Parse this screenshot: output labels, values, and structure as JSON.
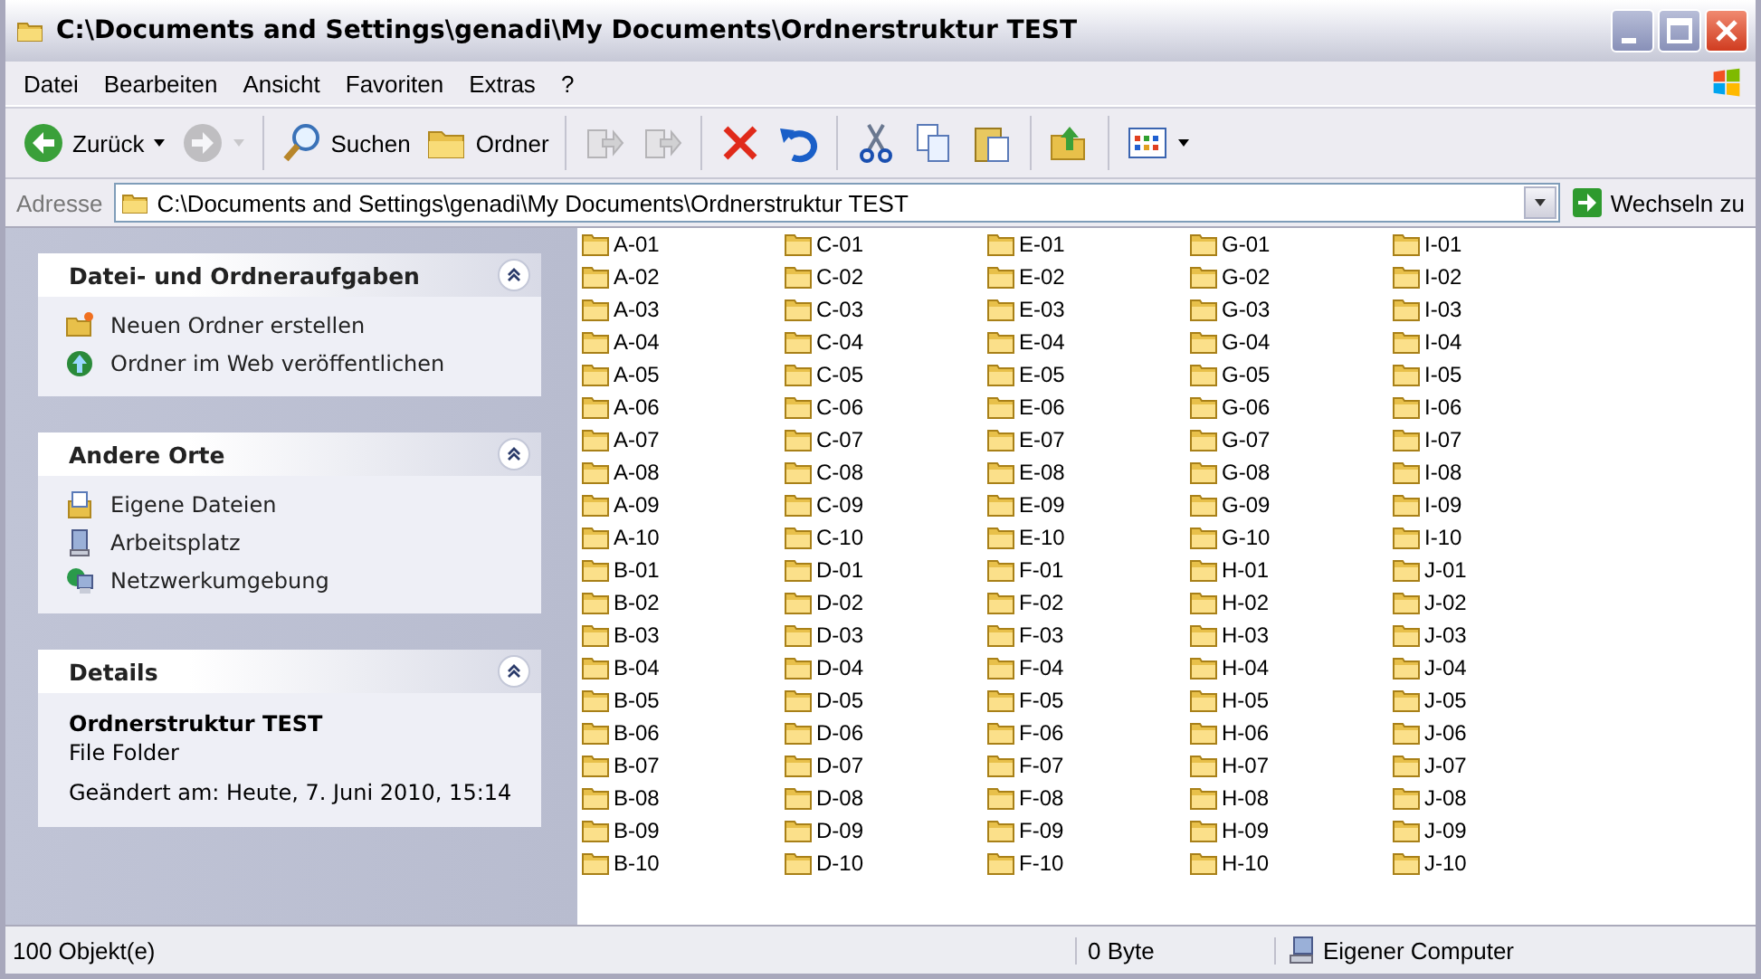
{
  "window": {
    "title": "C:\\Documents and Settings\\genadi\\My Documents\\Ordnerstruktur TEST"
  },
  "menu": [
    "Datei",
    "Bearbeiten",
    "Ansicht",
    "Favoriten",
    "Extras",
    "?"
  ],
  "toolbar": [
    {
      "kind": "back",
      "label": "Zurück",
      "disabled": false,
      "dropdown": true
    },
    {
      "kind": "forward",
      "disabled": true,
      "dropdown": true
    },
    {
      "kind": "sep"
    },
    {
      "kind": "search",
      "label": "Suchen",
      "disabled": false
    },
    {
      "kind": "folders",
      "label": "Ordner",
      "disabled": false
    },
    {
      "kind": "sep"
    },
    {
      "kind": "moveto",
      "disabled": true
    },
    {
      "kind": "copyto",
      "disabled": true
    },
    {
      "kind": "sep"
    },
    {
      "kind": "delete",
      "disabled": false
    },
    {
      "kind": "undo",
      "disabled": false
    },
    {
      "kind": "sep"
    },
    {
      "kind": "cut",
      "disabled": false
    },
    {
      "kind": "copy",
      "disabled": false
    },
    {
      "kind": "paste",
      "disabled": false
    },
    {
      "kind": "sep"
    },
    {
      "kind": "up",
      "disabled": false
    },
    {
      "kind": "sep"
    },
    {
      "kind": "views",
      "disabled": false,
      "dropdown": true
    }
  ],
  "address": {
    "label": "Adresse",
    "value": "C:\\Documents and Settings\\genadi\\My Documents\\Ordnerstruktur TEST",
    "go": "Wechseln zu"
  },
  "panels": [
    {
      "title": "Datei- und Ordneraufgaben",
      "items": [
        {
          "kind": "newfolder",
          "label": "Neuen Ordner erstellen"
        },
        {
          "kind": "web",
          "label": "Ordner im Web veröffentlichen"
        }
      ]
    },
    {
      "title": "Andere Orte",
      "items": [
        {
          "kind": "docs",
          "label": "Eigene Dateien"
        },
        {
          "kind": "computer",
          "label": "Arbeitsplatz"
        },
        {
          "kind": "network",
          "label": "Netzwerkumgebung"
        }
      ]
    }
  ],
  "details": {
    "title": "Details",
    "name": "Ordnerstruktur TEST",
    "type": "File Folder",
    "modified": "Geändert am: Heute, 7. Juni 2010, 15:14"
  },
  "files": [
    "A-01",
    "A-02",
    "A-03",
    "A-04",
    "A-05",
    "A-06",
    "A-07",
    "A-08",
    "A-09",
    "A-10",
    "B-01",
    "B-02",
    "B-03",
    "B-04",
    "B-05",
    "B-06",
    "B-07",
    "B-08",
    "B-09",
    "B-10",
    "C-01",
    "C-02",
    "C-03",
    "C-04",
    "C-05",
    "C-06",
    "C-07",
    "C-08",
    "C-09",
    "C-10",
    "D-01",
    "D-02",
    "D-03",
    "D-04",
    "D-05",
    "D-06",
    "D-07",
    "D-08",
    "D-09",
    "D-10",
    "E-01",
    "E-02",
    "E-03",
    "E-04",
    "E-05",
    "E-06",
    "E-07",
    "E-08",
    "E-09",
    "E-10",
    "F-01",
    "F-02",
    "F-03",
    "F-04",
    "F-05",
    "F-06",
    "F-07",
    "F-08",
    "F-09",
    "F-10",
    "G-01",
    "G-02",
    "G-03",
    "G-04",
    "G-05",
    "G-06",
    "G-07",
    "G-08",
    "G-09",
    "G-10",
    "H-01",
    "H-02",
    "H-03",
    "H-04",
    "H-05",
    "H-06",
    "H-07",
    "H-08",
    "H-09",
    "H-10",
    "I-01",
    "I-02",
    "I-03",
    "I-04",
    "I-05",
    "I-06",
    "I-07",
    "I-08",
    "I-09",
    "I-10",
    "J-01",
    "J-02",
    "J-03",
    "J-04",
    "J-05",
    "J-06",
    "J-07",
    "J-08",
    "J-09",
    "J-10"
  ],
  "status_bar": {
    "count": "100 Objekt(e)",
    "size": "0 Byte",
    "location": "Eigener Computer"
  }
}
